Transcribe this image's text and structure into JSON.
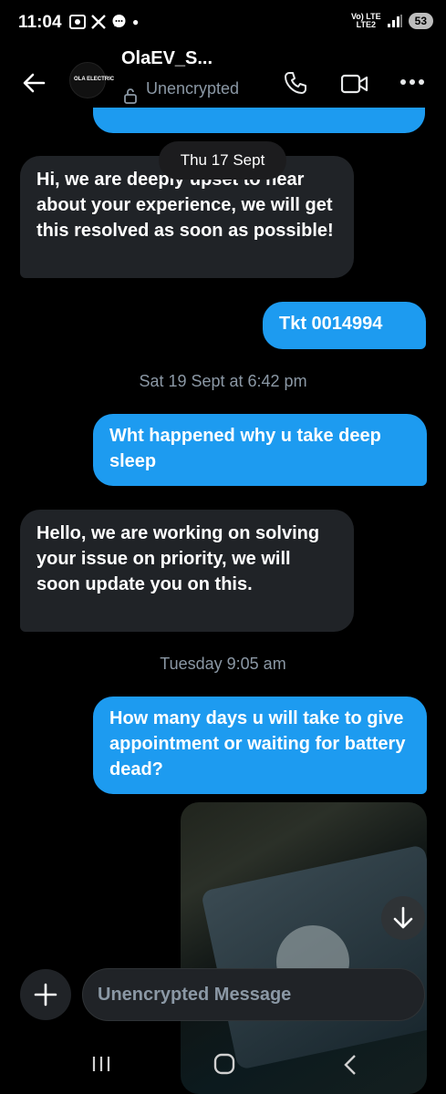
{
  "status": {
    "time": "11:04",
    "notif_icons": [
      "screenshot-icon",
      "x-icon",
      "chat-icon"
    ],
    "network_top": "Vo) LTE",
    "network_bottom": "LTE2",
    "battery": "53"
  },
  "header": {
    "contact_name": "OlaEV_S...",
    "avatar_text": "OLA ELECTRIC",
    "encryption_label": "Unencrypted"
  },
  "messages": [
    {
      "type": "date",
      "text": "Thu 17 Sept"
    },
    {
      "type": "in",
      "text": "Hi, we are deeply upset to hear about your experience, we will get this resolved as soon as possible!"
    },
    {
      "type": "out",
      "text": "Tkt 0014994"
    },
    {
      "type": "date",
      "text": "Sat 19 Sept at 6:42 pm"
    },
    {
      "type": "out",
      "text": "Wht happened why  u take deep sleep"
    },
    {
      "type": "in",
      "text": "Hello, we are working on solving your issue on priority, we will soon update you on this."
    },
    {
      "type": "date",
      "text": "Tuesday 9:05 am"
    },
    {
      "type": "out",
      "text": "How many days u will take to give appointment or waiting for battery dead?"
    }
  ],
  "composer": {
    "placeholder": "Unencrypted Message"
  },
  "colors": {
    "accent": "#1d9bf0",
    "incoming_bubble": "#202327",
    "background": "#000000",
    "muted_text": "#8b98a5"
  }
}
